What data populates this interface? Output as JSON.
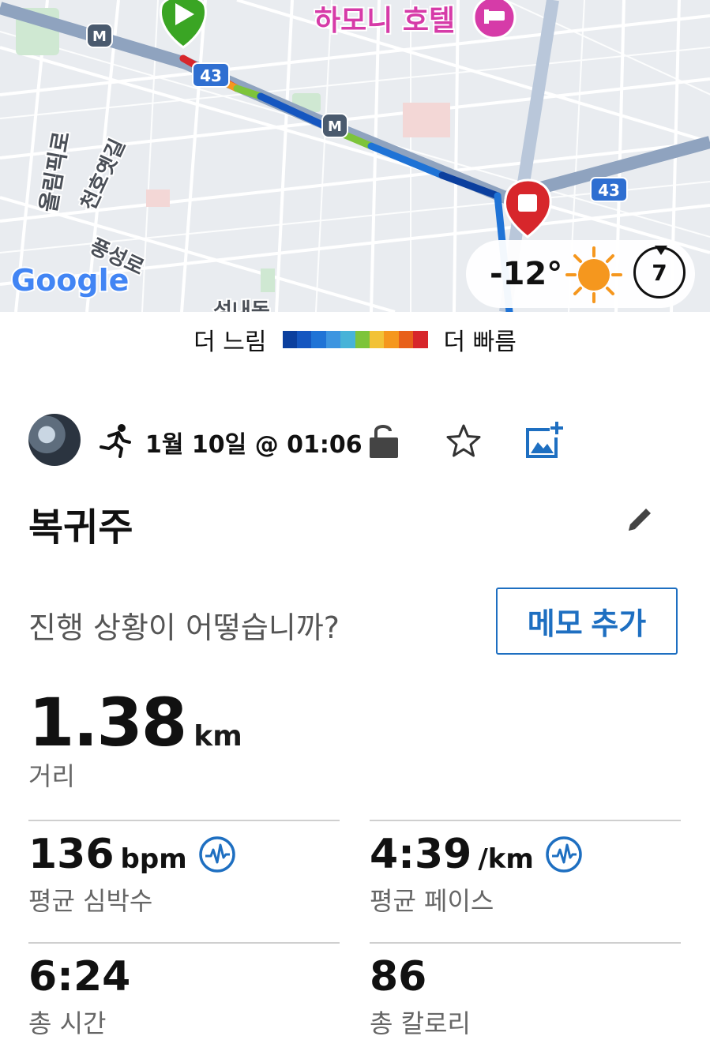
{
  "map": {
    "hotel_label": "하모니 호텔",
    "road_label_1": "올림픽로",
    "road_label_2": "천호옛길",
    "road_label_3": "풍성로",
    "road_label_4": "성내동",
    "route_badge": "43",
    "metro_badge": "M",
    "google_logo": "Google",
    "weather": {
      "temperature": "-12°",
      "condition_icon": "sun-icon",
      "wind_value": "7"
    }
  },
  "legend": {
    "slow_label": "더 느림",
    "fast_label": "더 빠름",
    "colors": [
      "#0b3f9e",
      "#1556c0",
      "#1f73d6",
      "#3d95e0",
      "#47b3d8",
      "#7dc43a",
      "#f2c237",
      "#f5971e",
      "#e8601a",
      "#d7262b"
    ]
  },
  "activity": {
    "type_icon": "running-icon",
    "date": "1월 10일 @ 01:06",
    "title": "복귀주",
    "note_prompt": "진행 상황이 어떻습니까?",
    "memo_button": "메모 추가",
    "accent_color": "#1e6fc1"
  },
  "stats": {
    "distance": {
      "value": "1.38",
      "unit": "km",
      "label": "거리"
    },
    "heart_rate": {
      "value": "136",
      "unit": "bpm",
      "label": "평균 심박수"
    },
    "pace": {
      "value": "4:39",
      "unit": "/km",
      "label": "평균 페이스"
    },
    "time": {
      "value": "6:24",
      "label": "총 시간"
    },
    "calories": {
      "value": "86",
      "label": "총 칼로리"
    }
  }
}
